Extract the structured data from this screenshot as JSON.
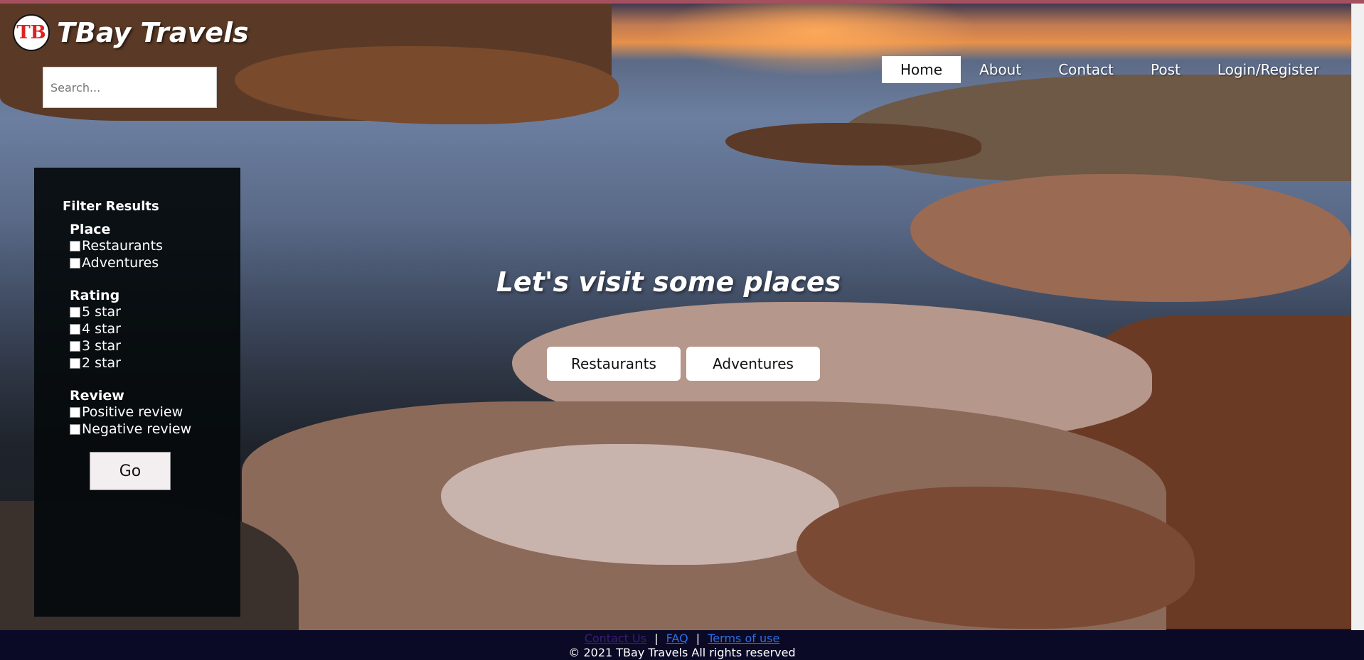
{
  "brand": {
    "badge_text": "TB",
    "title": "TBay Travels"
  },
  "search": {
    "placeholder": "Search..."
  },
  "nav": [
    {
      "label": "Home",
      "active": true
    },
    {
      "label": "About",
      "active": false
    },
    {
      "label": "Contact",
      "active": false
    },
    {
      "label": "Post",
      "active": false
    },
    {
      "label": "Login/Register",
      "active": false
    }
  ],
  "filter": {
    "title": "Filter Results",
    "place": {
      "title": "Place",
      "options": [
        "Restaurants",
        "Adventures"
      ]
    },
    "rating": {
      "title": "Rating",
      "options": [
        "5 star",
        "4 star",
        "3 star",
        "2 star"
      ]
    },
    "review": {
      "title": "Review",
      "options": [
        "Positive review",
        "Negative review"
      ]
    },
    "go_label": "Go"
  },
  "hero": {
    "headline": "Let's visit some places",
    "buttons": [
      "Restaurants",
      "Adventures"
    ]
  },
  "footer": {
    "links": [
      "Contact Us",
      "FAQ",
      "Terms of use"
    ],
    "separator": "|",
    "copyright": "© 2021 TBay Travels All rights reserved"
  },
  "colors": {
    "topline": "#a4505e",
    "footer_bg": "#0b0a26",
    "filter_bg": "#050a0c",
    "link": "#2b6fe6",
    "link_visited": "#3b1d78"
  }
}
